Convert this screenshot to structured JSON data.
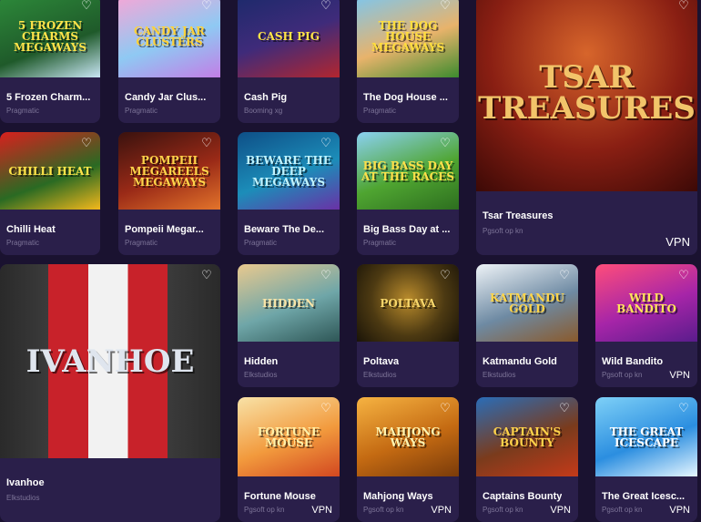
{
  "games": [
    {
      "title": "5 Frozen Charm...",
      "provider": "Pragmatic",
      "art": "5 FROZEN CHARMS MEGAWAYS",
      "vpn": "",
      "bg": "linear-gradient(160deg,#2d8a3a,#1f5a2a 60%,#c9e6f5)",
      "fg": "#ffe34a"
    },
    {
      "title": "Candy Jar Clus...",
      "provider": "Pragmatic",
      "art": "CANDY JAR CLUSTERS",
      "vpn": "",
      "bg": "linear-gradient(160deg,#f7a6d6,#8fc9f3 55%,#c27ee6)",
      "fg": "#ffd23a"
    },
    {
      "title": "Cash Pig",
      "provider": "Booming xg",
      "art": "CASH PIG",
      "vpn": "",
      "bg": "linear-gradient(160deg,#1c2a6b,#3f2b7a 50%,#b2262f)",
      "fg": "#ffe347"
    },
    {
      "title": "The Dog House ...",
      "provider": "Pragmatic",
      "art": "THE DOG HOUSE MEGAWAYS",
      "vpn": "",
      "bg": "linear-gradient(160deg,#7cc6ef,#e8b36b 55%,#3c8b2e)",
      "fg": "#ffde3d"
    },
    {
      "title": "Tsar Treasures",
      "provider": "Pgsoft op kn",
      "art": "TSAR TREASURES",
      "vpn": "VPN",
      "bg": "radial-gradient(circle at 50% 30%,#d7652b,#8a1f13 55%,#3c0906)",
      "fg": "#f2c46a"
    },
    {
      "title": "Chilli Heat",
      "provider": "Pragmatic",
      "art": "CHILLI HEAT",
      "vpn": "",
      "bg": "linear-gradient(160deg,#d8201e,#2a6a23 60%,#f3b81c)",
      "fg": "#ffe54a"
    },
    {
      "title": "Pompeii Megar...",
      "provider": "Pragmatic",
      "art": "POMPEII MEGAREELS MEGAWAYS",
      "vpn": "",
      "bg": "linear-gradient(160deg,#3a120e,#9a2a17 55%,#e3742b)",
      "fg": "#ffd34a"
    },
    {
      "title": "Beware The De...",
      "provider": "Pragmatic",
      "art": "BEWARE THE DEEP MEGAWAYS",
      "vpn": "",
      "bg": "linear-gradient(160deg,#0e4f87,#1c8db9 55%,#6a31a6)",
      "fg": "#bff3ff"
    },
    {
      "title": "Big Bass Day at ...",
      "provider": "Pragmatic",
      "art": "BIG BASS DAY AT THE RACES",
      "vpn": "",
      "bg": "linear-gradient(160deg,#8bd1f2,#4fa531 55%,#2d6e1f)",
      "fg": "#ffe04a"
    },
    {
      "title": "Ivanhoe",
      "provider": "Elkstudios",
      "art": "IVANHOE",
      "vpn": "",
      "bg": "linear-gradient(90deg,#2a2a2a 0%,#3b3b3b 22%,#c8222a 22%,#c8222a 40%,#f2f2f2 40%,#f2f2f2 58%,#c8222a 58%,#c8222a 76%,#3b3b3b 76%,#2a2a2a 100%)",
      "fg": "#dfe5ee"
    },
    {
      "title": "Hidden",
      "provider": "Elkstudios",
      "art": "HIDDEN",
      "vpn": "",
      "bg": "linear-gradient(160deg,#e9c98e,#6fa6a8 55%,#2e5656)",
      "fg": "#f8e4a8"
    },
    {
      "title": "Poltava",
      "provider": "Elkstudios",
      "art": "POLTAVA",
      "vpn": "",
      "bg": "radial-gradient(circle at 50% 45%,#b98b2c,#4d3a12 55%,#1a1408)",
      "fg": "#f6d66b"
    },
    {
      "title": "Katmandu Gold",
      "provider": "Elkstudios",
      "art": "KATMANDU GOLD",
      "vpn": "",
      "bg": "linear-gradient(160deg,#eef3f7,#6e8aa3 55%,#8a5a2c)",
      "fg": "#ffd54a"
    },
    {
      "title": "Wild Bandito",
      "provider": "Pgsoft op kn",
      "art": "WILD BANDITO",
      "vpn": "VPN",
      "bg": "linear-gradient(160deg,#ff4d7a,#a625a8 55%,#5a1c8c)",
      "fg": "#ffe55a"
    },
    {
      "title": "Fortune Mouse",
      "provider": "Pgsoft op kn",
      "art": "FORTUNE MOUSE",
      "vpn": "VPN",
      "bg": "linear-gradient(160deg,#f8e2a7,#f29a3d 55%,#d24720)",
      "fg": "#fff0a8"
    },
    {
      "title": "Mahjong Ways",
      "provider": "Pgsoft op kn",
      "art": "MAHJONG WAYS",
      "vpn": "VPN",
      "bg": "linear-gradient(160deg,#f6b342,#c46a12 55%,#7a3b0a)",
      "fg": "#fff4b0"
    },
    {
      "title": "Captains Bounty",
      "provider": "Pgsoft op kn",
      "art": "CAPTAIN'S BOUNTY",
      "vpn": "VPN",
      "bg": "linear-gradient(160deg,#2a6db8,#7a3b1c 55%,#c43a1a)",
      "fg": "#ffd24a"
    },
    {
      "title": "The Great Icesc...",
      "provider": "Pgsoft op kn",
      "art": "THE GREAT ICESCAPE",
      "vpn": "VPN",
      "bg": "linear-gradient(160deg,#7ed0f7,#2b8ee0 55%,#e6f6ff)",
      "fg": "#ffffff"
    }
  ],
  "icons": {
    "favorite": "heart-outline-icon"
  }
}
